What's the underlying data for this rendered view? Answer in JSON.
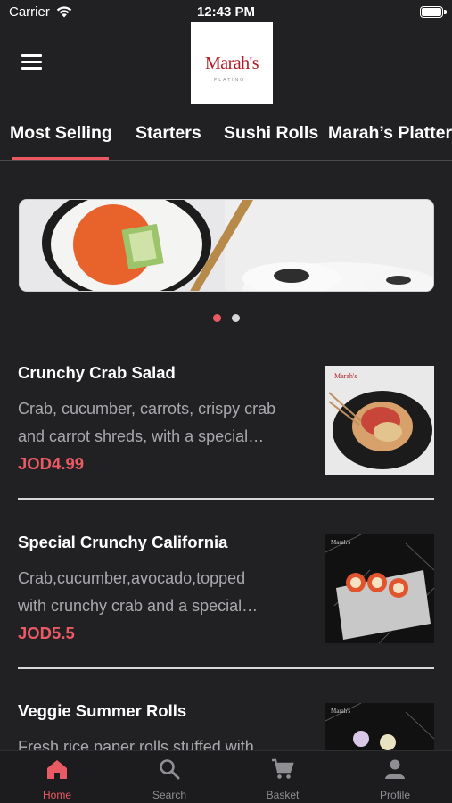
{
  "status": {
    "carrier": "Carrier",
    "time": "12:43 PM"
  },
  "header": {
    "logo_text": "Marah's",
    "logo_sub": "PLATING"
  },
  "tabs": [
    {
      "label": "Most Selling",
      "active": true
    },
    {
      "label": "Starters",
      "active": false
    },
    {
      "label": "Sushi Rolls",
      "active": false
    },
    {
      "label": "Marah’s Platters",
      "active": false
    }
  ],
  "banner": {
    "page_count": 2,
    "active_page": 1
  },
  "items": [
    {
      "name": "Crunchy Crab Salad",
      "description_line1": "Crab, cucumber, carrots, crispy crab",
      "description_line2": "and carrot shreds, with a special…",
      "price": "JOD4.99"
    },
    {
      "name": "Special Crunchy California",
      "description_line1": "Crab,cucumber,avocado,topped",
      "description_line2": "with crunchy crab and a special…",
      "price": "JOD5.5"
    },
    {
      "name": "Veggie Summer Rolls",
      "description_line1": "Fresh rice paper rolls stuffed with",
      "description_line2": "",
      "price": ""
    }
  ],
  "bottom_nav": [
    {
      "label": "Home",
      "icon": "home-icon",
      "active": true
    },
    {
      "label": "Search",
      "icon": "search-icon",
      "active": false
    },
    {
      "label": "Basket",
      "icon": "cart-icon",
      "active": false
    },
    {
      "label": "Profile",
      "icon": "profile-icon",
      "active": false
    }
  ],
  "colors": {
    "accent": "#ea5a64",
    "background": "#212124",
    "inactive": "#8e8e93",
    "text_secondary": "#a8a8ad"
  }
}
